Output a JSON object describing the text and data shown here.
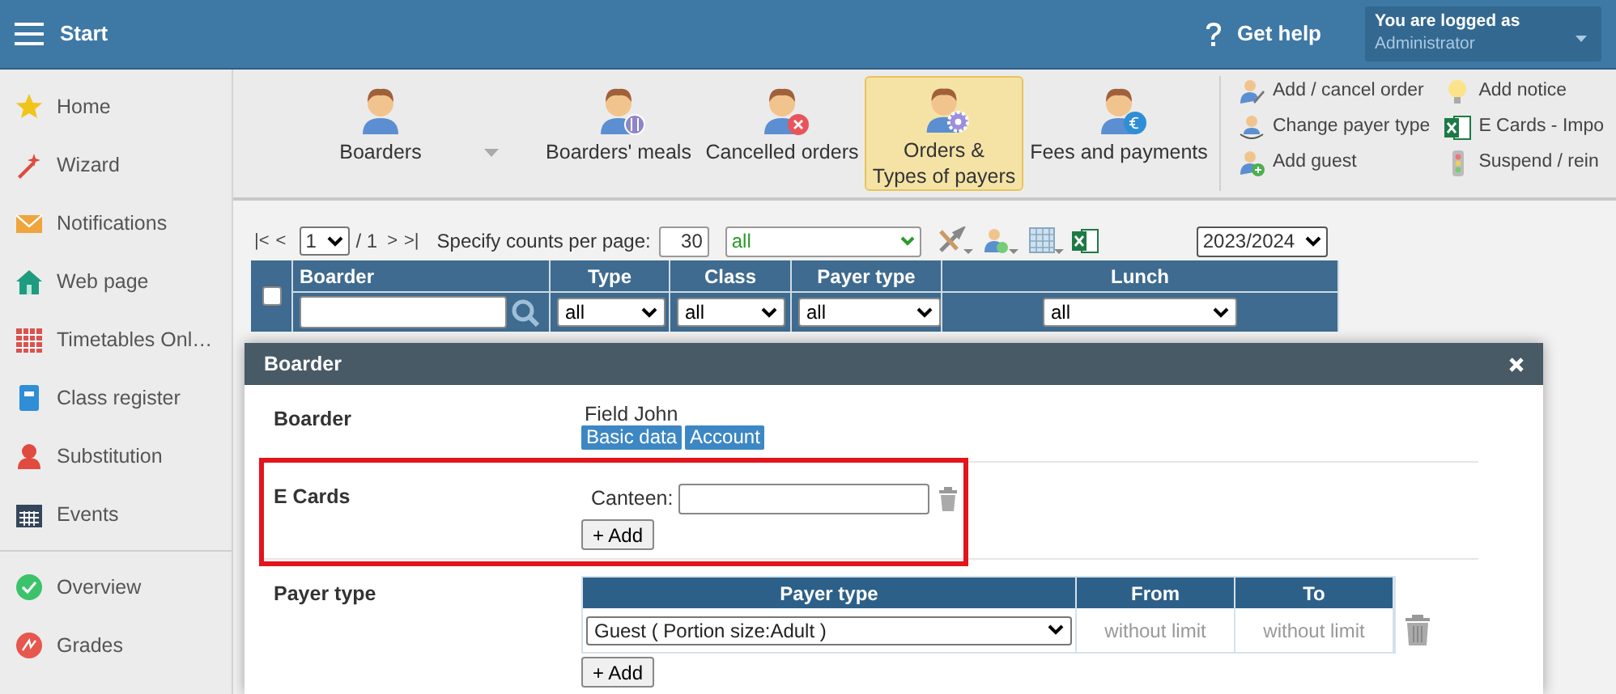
{
  "header": {
    "menu_label": "Start",
    "help": "Get help",
    "user_caption": "You are logged as",
    "user_name": "Administrator"
  },
  "sidebar": {
    "groups": [
      [
        {
          "label": "Home"
        },
        {
          "label": "Wizard"
        },
        {
          "label": "Notifications"
        },
        {
          "label": "Web page"
        },
        {
          "label": "Timetables Onl…"
        },
        {
          "label": "Class register"
        },
        {
          "label": "Substitution"
        },
        {
          "label": "Events"
        }
      ],
      [
        {
          "label": "Overview"
        },
        {
          "label": "Grades"
        }
      ]
    ]
  },
  "toolbar": {
    "big_buttons": [
      {
        "label_lines": [
          "Boarders"
        ],
        "selected": false,
        "dropdown": true
      },
      {
        "label_lines": [
          "Boarders' meals"
        ],
        "selected": false,
        "dropdown": false
      },
      {
        "label_lines": [
          "Cancelled orders"
        ],
        "selected": false,
        "dropdown": false
      },
      {
        "label_lines": [
          "Orders &",
          "Types of payers"
        ],
        "selected": true,
        "dropdown": false
      },
      {
        "label_lines": [
          "Fees and payments"
        ],
        "selected": false,
        "dropdown": false
      }
    ],
    "actions": [
      [
        "Add / cancel order",
        "Change payer type",
        "Add guest"
      ],
      [
        "Add notice",
        "E Cards - Impo",
        "Suspend / rein"
      ]
    ]
  },
  "pager": {
    "first": "|<",
    "prev": "<",
    "page": "1",
    "of": "/ 1",
    "next": ">",
    "last": ">|",
    "counts_label": "Specify counts per page:",
    "count": "30",
    "filter": "all",
    "year": "2023/2024"
  },
  "table": {
    "select_all_checked": false,
    "columns": [
      "Boarder",
      "Type",
      "Class",
      "Payer type",
      "Lunch"
    ],
    "filters": [
      "all",
      "all",
      "all",
      "all"
    ]
  },
  "dialog": {
    "title": "Boarder",
    "boarder_label": "Boarder",
    "boarder_name": "Field John",
    "boarder_buttons": [
      "Basic data",
      "Account"
    ],
    "ecards_label": "E Cards",
    "canteen_label": "Canteen:",
    "ecards_add": "+ Add",
    "payer_label": "Payer type",
    "payer_columns": [
      "Payer type",
      "From",
      "To"
    ],
    "payer_rows": [
      {
        "type": "Guest ( Portion size:Adult )",
        "from": "without limit",
        "to": "without limit"
      }
    ],
    "payer_add": "+ Add"
  }
}
